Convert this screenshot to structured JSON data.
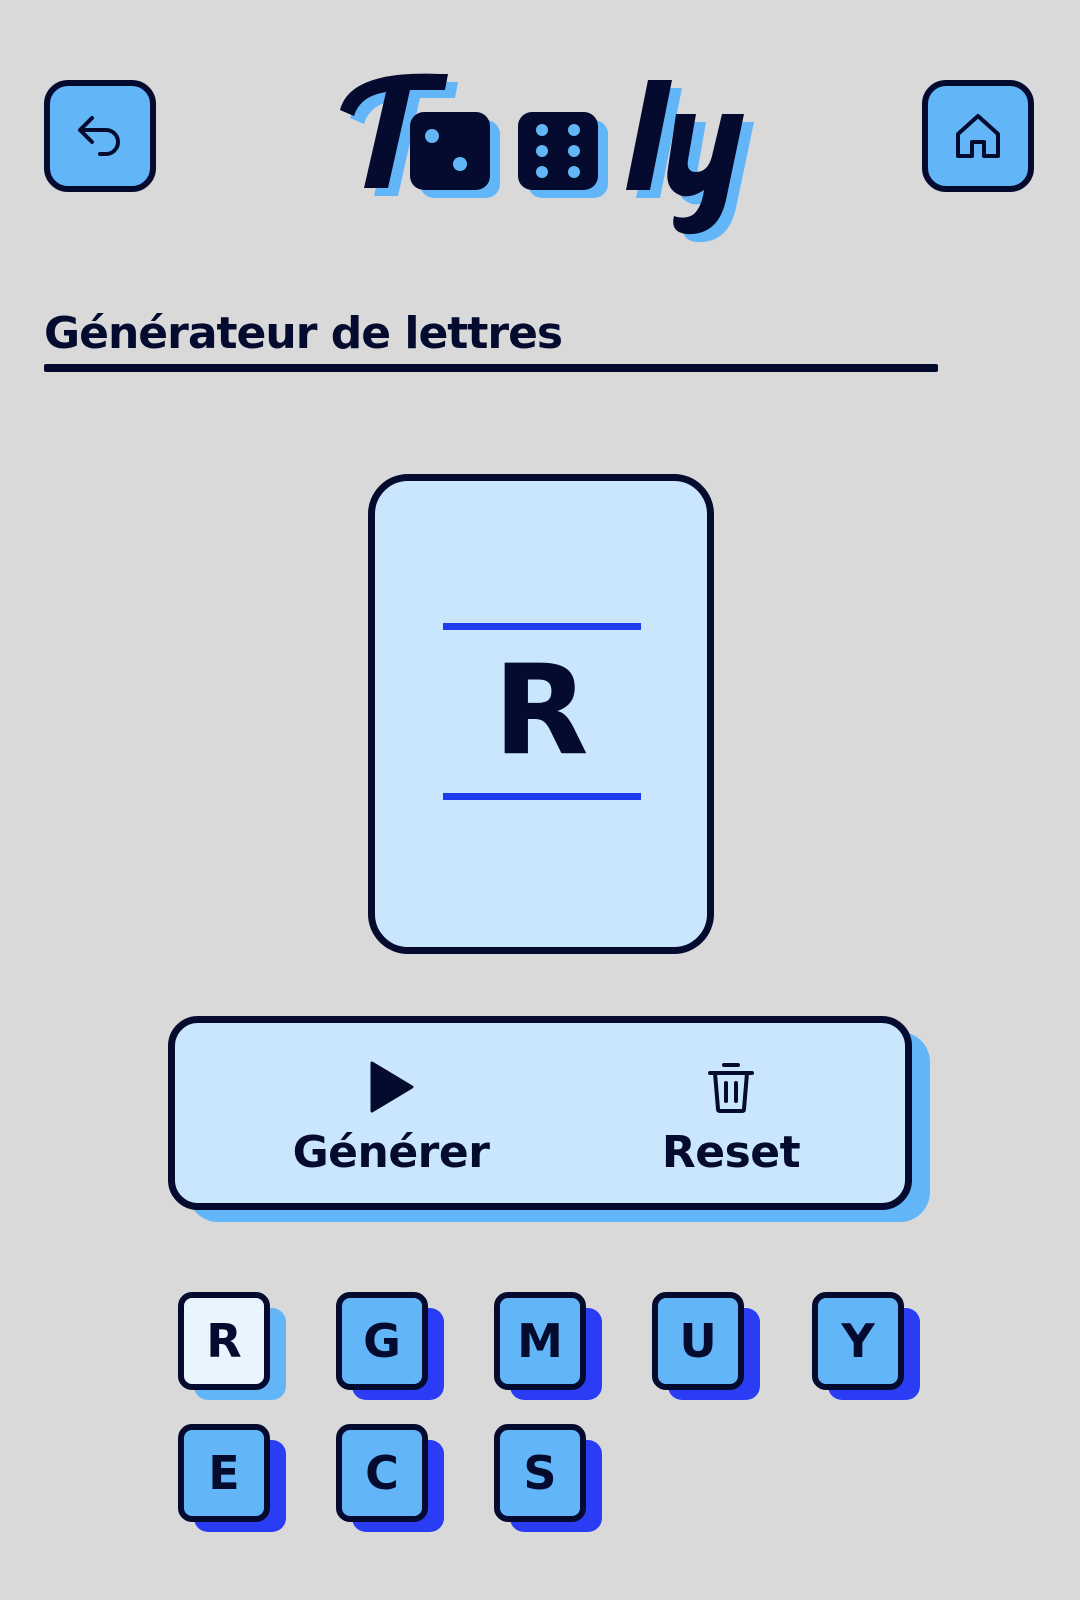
{
  "header": {
    "logo_text": "Tooly",
    "back_icon": "back-arrow-icon",
    "home_icon": "home-icon"
  },
  "section": {
    "title": "Générateur de lettres"
  },
  "card": {
    "current_letter": "R"
  },
  "actions": {
    "generate_label": "Générer",
    "generate_icon": "play-icon",
    "reset_label": "Reset",
    "reset_icon": "trash-icon"
  },
  "history": [
    "R",
    "G",
    "M",
    "U",
    "Y",
    "E",
    "C",
    "S"
  ],
  "colors": {
    "background": "#d9d9d9",
    "ink": "#050b2e",
    "accent_light": "#c9e6fd",
    "accent": "#62b6f8",
    "accent_strong": "#1f3bf0"
  }
}
